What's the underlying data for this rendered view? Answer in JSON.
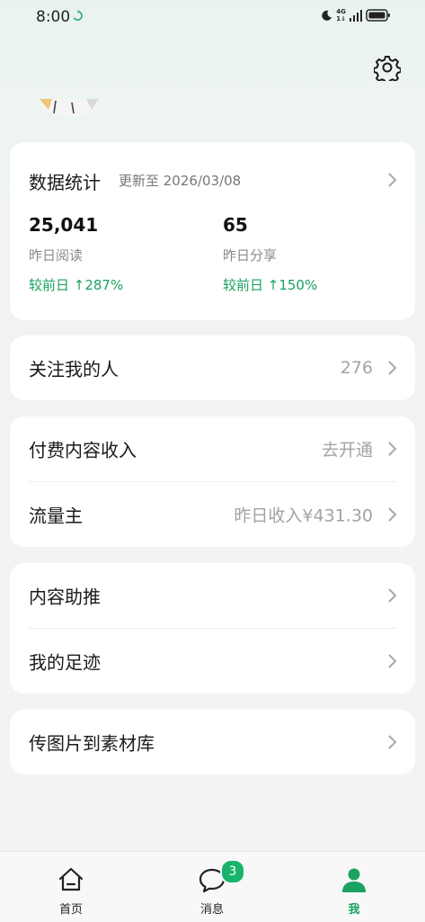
{
  "status_bar": {
    "time": "8:00",
    "network_label_top": "4G",
    "network_label_bottom": "1↓"
  },
  "stats": {
    "title": "数据统计",
    "updated": "更新至 2026/03/08",
    "items": [
      {
        "value": "25,041",
        "label": "昨日阅读",
        "change": "较前日 ↑287%"
      },
      {
        "value": "65",
        "label": "昨日分享",
        "change": "较前日 ↑150%"
      }
    ]
  },
  "rows": {
    "followers": {
      "label": "关注我的人",
      "value": "276"
    },
    "paid_content": {
      "label": "付费内容收入",
      "value": "去开通"
    },
    "traffic_owner": {
      "label": "流量主",
      "value": "昨日收入¥431.30"
    },
    "content_boost": {
      "label": "内容助推"
    },
    "my_footprint": {
      "label": "我的足迹"
    },
    "upload_images": {
      "label": "传图片到素材库"
    }
  },
  "nav": {
    "items": [
      {
        "label": "首页",
        "icon": "home-icon"
      },
      {
        "label": "消息",
        "icon": "chat-bubble-icon",
        "badge": "3"
      },
      {
        "label": "我",
        "icon": "person-icon",
        "active": true
      }
    ]
  },
  "colors": {
    "accent_green": "#1aa260",
    "badge_green": "#19b36b",
    "muted_text": "#a3a3a3"
  }
}
